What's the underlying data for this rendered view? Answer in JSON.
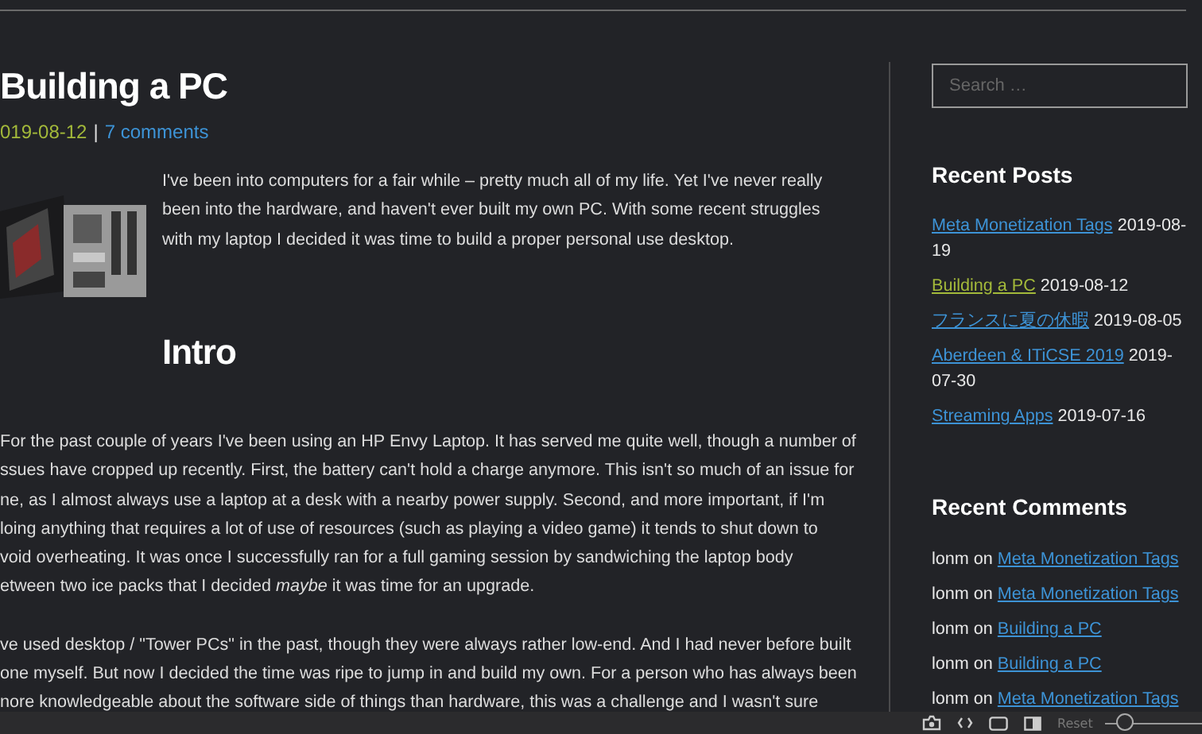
{
  "post": {
    "title": "Building a PC",
    "date": "019-08-12",
    "separator": "|",
    "comments_link": "7 comments",
    "intro": "I've been into computers for a fair while – pretty much all of my life. Yet I've never really been into the hardware, and haven't ever built my own PC. With some recent struggles with my laptop I decided it was time to build a proper personal use desktop.",
    "heading": "Intro",
    "paragraphs": [
      {
        "lines": [
          "For the past couple of years I've been using an HP Envy Laptop. It has served me quite well, though a number of",
          "ssues have cropped up recently. First, the battery can't hold a charge anymore. This isn't so much of an issue for",
          "ne, as I almost always use a laptop at a desk with a nearby power supply. Second, and more important, if I'm",
          "loing anything that requires a lot of use of resources (such as playing a video game) it tends to shut down to",
          "void overheating. It was once I successfully ran for a full gaming session by sandwiching the laptop body",
          "etween two ice packs that I decided *maybe* it was time for an upgrade."
        ]
      },
      {
        "lines": [
          "ve used desktop / \"Tower PCs\" in the past, though they were always rather low-end. And I had never before built",
          "one myself. But now I decided the time was ripe to jump in and build my own. For a person who has always been",
          "nore knowledgeable about the software side of things than hardware, this was a challenge and I wasn't sure"
        ]
      }
    ]
  },
  "sidebar": {
    "search": {
      "placeholder": "Search …"
    },
    "recent_posts": {
      "title": "Recent Posts",
      "items": [
        {
          "title": "Meta Monetization Tags",
          "date": "2019-08-19",
          "current": false
        },
        {
          "title": "Building a PC",
          "date": "2019-08-12",
          "current": true
        },
        {
          "title": "フランスに夏の休暇",
          "date": "2019-08-05",
          "current": false
        },
        {
          "title": "Aberdeen & ITiCSE 2019",
          "date": "2019-07-30",
          "current": false
        },
        {
          "title": "Streaming Apps",
          "date": "2019-07-16",
          "current": false
        }
      ]
    },
    "recent_comments": {
      "title": "Recent Comments",
      "items": [
        {
          "author": "lonm",
          "joiner": "on",
          "post": "Meta Monetization Tags"
        },
        {
          "author": "lonm",
          "joiner": "on",
          "post": "Meta Monetization Tags"
        },
        {
          "author": "lonm",
          "joiner": "on",
          "post": "Building a PC"
        },
        {
          "author": "lonm",
          "joiner": "on",
          "post": "Building a PC"
        },
        {
          "author": "lonm",
          "joiner": "on",
          "post": "Meta Monetization Tags"
        }
      ]
    }
  },
  "toolbar": {
    "reset": "Reset",
    "zoom": {
      "level": 0.2
    }
  }
}
